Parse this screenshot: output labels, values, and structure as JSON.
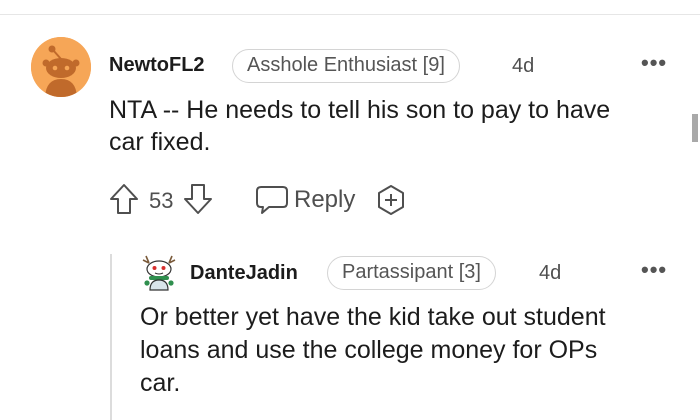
{
  "comment": {
    "username": "NewtoFL2",
    "flair": "Asshole Enthusiast [9]",
    "age": "4d",
    "more": "•••",
    "body_line1": "NTA -- He needs to tell his son to pay to have",
    "body_line2": "car fixed.",
    "votes": "53",
    "reply_label": "Reply",
    "avatar_icon": "reddit-snoo-avatar-icon",
    "avatar_color": "#f6a657"
  },
  "reply": {
    "username": "DanteJadin",
    "flair": "Partassipant [3]",
    "age": "4d",
    "more": "•••",
    "body_line1": "Or better yet have the kid take out student",
    "body_line2": "loans and use the college money for OPs",
    "body_line3": "car.",
    "avatar_icon": "snoo-costume-avatar-icon"
  }
}
